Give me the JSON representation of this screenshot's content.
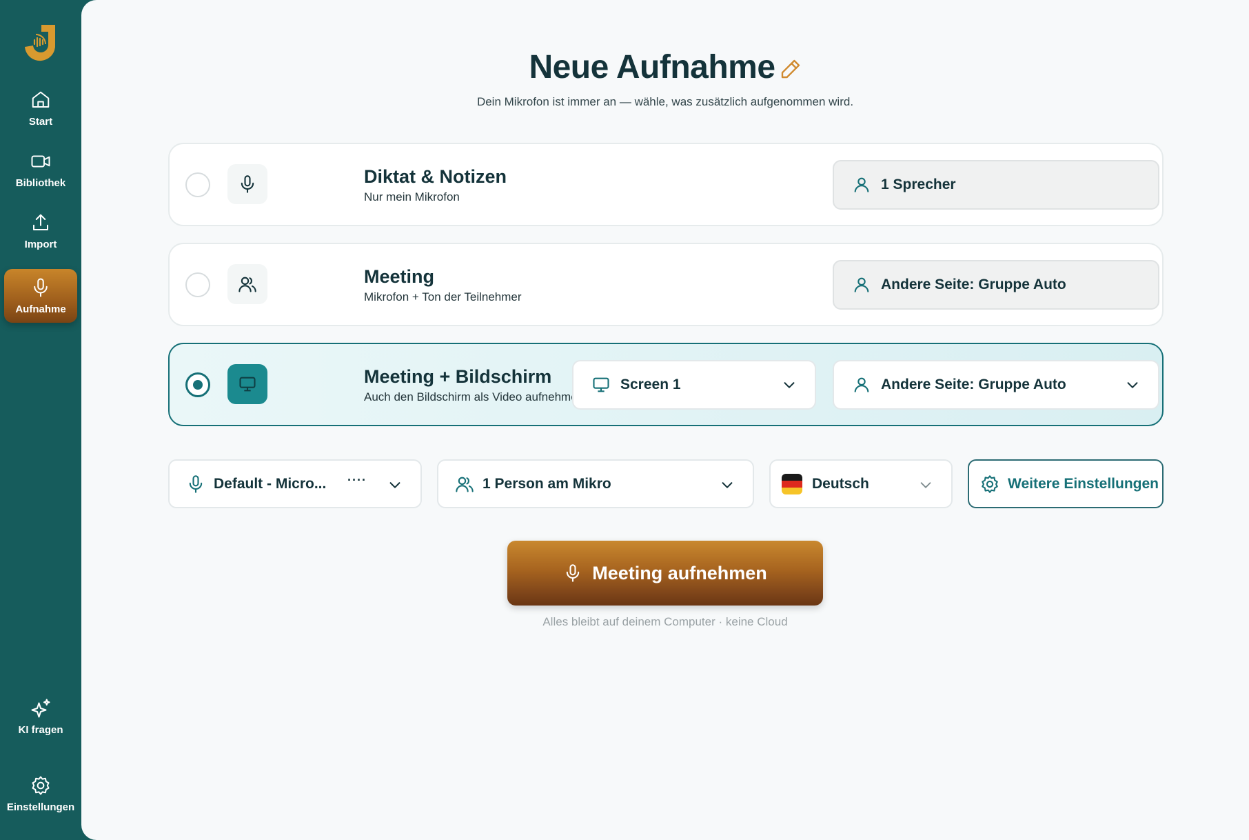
{
  "sidebar": {
    "items": [
      {
        "label": "Start",
        "icon": "home-icon"
      },
      {
        "label": "Bibliothek",
        "icon": "video-camera-icon"
      },
      {
        "label": "Import",
        "icon": "upload-icon"
      },
      {
        "label": "Aufnahme",
        "icon": "microphone-icon",
        "active": true
      }
    ],
    "bottom_items": [
      {
        "label": "KI fragen",
        "icon": "sparkles-icon"
      },
      {
        "label": "Einstellungen",
        "icon": "gear-icon"
      }
    ]
  },
  "header": {
    "title": "Neue Aufnahme",
    "subtitle": "Dein Mikrofon ist immer an — wähle, was zusätzlich aufgenommen wird."
  },
  "modes": [
    {
      "title": "Diktat & Notizen",
      "subtitle": "Nur mein Mikrofon",
      "speaker": "1 Sprecher",
      "selected": false
    },
    {
      "title": "Meeting",
      "subtitle": "Mikrofon + Ton der Teilnehmer",
      "speaker": "Andere Seite: Gruppe Auto",
      "selected": false
    },
    {
      "title": "Meeting + Bildschirm",
      "subtitle": "Auch den Bildschirm als Video aufnehmen",
      "screen": "Screen 1",
      "speaker": "Andere Seite: Gruppe Auto",
      "selected": true
    }
  ],
  "controls": {
    "microphone": "Default - Micro...",
    "microphone_more": "····",
    "persons": "1 Person am Mikro",
    "language": "Deutsch",
    "more_settings": "Weitere Einstellungen"
  },
  "record_button": "Meeting aufnehmen",
  "footnote": "Alles bleibt auf deinem Computer · keine Cloud",
  "colors": {
    "sidebar": "#165c5c",
    "accent": "#167077",
    "record_gradient_top": "#c9882f",
    "record_gradient_bottom": "#6a3613",
    "edit_icon": "#d08a2e"
  }
}
